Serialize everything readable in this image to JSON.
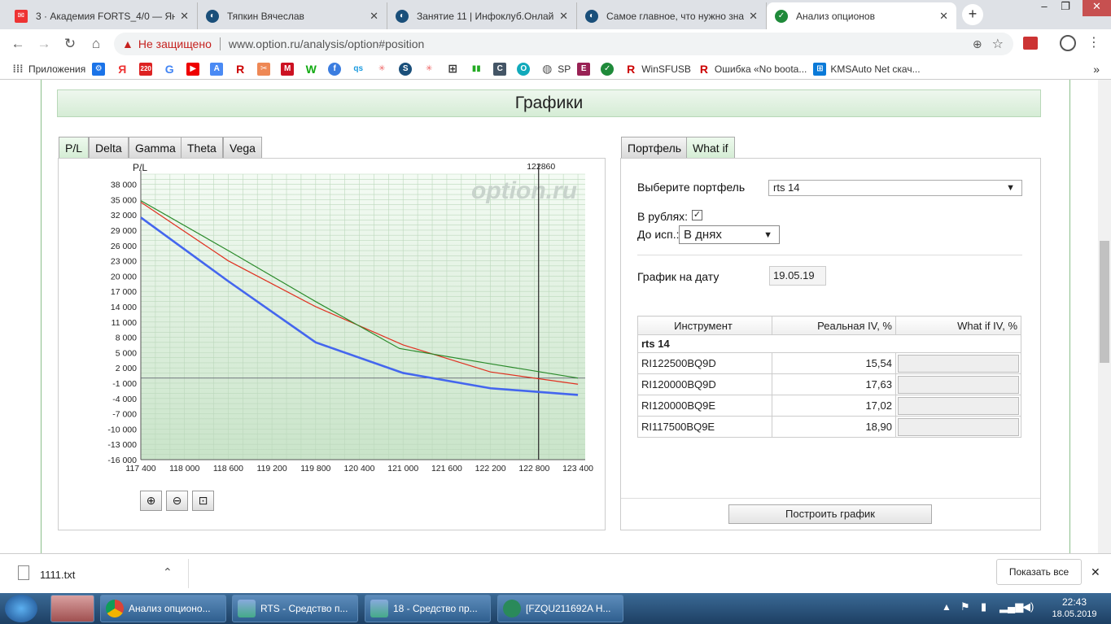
{
  "browser": {
    "tabs": [
      {
        "title": "3 · Академия FORTS_4/0 — Янд",
        "icon": "mail-icon"
      },
      {
        "title": "Тяпкин Вячеслав",
        "icon": "infoclub-icon"
      },
      {
        "title": "Занятие 11 | Инфоклуб.Онлайн",
        "icon": "infoclub-icon"
      },
      {
        "title": "Самое главное, что нужно зна",
        "icon": "infoclub-icon"
      },
      {
        "title": "Анализ опционов",
        "icon": "option-ru-icon",
        "active": true
      }
    ],
    "insecure_label": "Не защищено",
    "url": "www.option.ru/analysis/option#position",
    "bookmarks": [
      {
        "label": "Приложения"
      },
      {
        "label": ""
      },
      {
        "label": ""
      },
      {
        "label": ""
      },
      {
        "label": ""
      },
      {
        "label": ""
      },
      {
        "label": ""
      },
      {
        "label": ""
      },
      {
        "label": ""
      },
      {
        "label": ""
      },
      {
        "label": ""
      },
      {
        "label": ""
      },
      {
        "label": ""
      },
      {
        "label": ""
      },
      {
        "label": ""
      },
      {
        "label": ""
      },
      {
        "label": ""
      },
      {
        "label": ""
      },
      {
        "label": "SP"
      },
      {
        "label": ""
      },
      {
        "label": ""
      },
      {
        "label": "WinSFUSB"
      },
      {
        "label": "Ошибка «No boota..."
      },
      {
        "label": "KMSAuto Net скач..."
      }
    ]
  },
  "page": {
    "header": "Графики",
    "chart_tabs": [
      "P/L",
      "Delta",
      "Gamma",
      "Theta",
      "Vega"
    ],
    "right_tabs": [
      "Портфель",
      "What if"
    ],
    "form": {
      "portfolio_label": "Выберите портфель",
      "portfolio_value": "rts 14",
      "rub_label": "В рублях:",
      "expiry_label": "До исп.:",
      "expiry_value": "В днях",
      "date_label": "График на дату",
      "date_value": "19.05.19"
    },
    "iv_table": {
      "headers": [
        "Инструмент",
        "Реальная IV, %",
        "What if IV, %"
      ],
      "group": "rts 14",
      "rows": [
        {
          "instrument": "RI122500BQ9D",
          "iv": "15,54"
        },
        {
          "instrument": "RI120000BQ9D",
          "iv": "17,63"
        },
        {
          "instrument": "RI120000BQ9E",
          "iv": "17,02"
        },
        {
          "instrument": "RI117500BQ9E",
          "iv": "18,90"
        }
      ]
    },
    "build_button": "Построить график",
    "watermark": "option.ru"
  },
  "chart_data": {
    "type": "line",
    "ylabel": "P/L",
    "marker_label": "122860",
    "marker_x": 122860,
    "xlim": [
      117400,
      123500
    ],
    "ylim": [
      -16000,
      40000
    ],
    "x_ticks": [
      "117 400",
      "118 000",
      "118 600",
      "119 200",
      "119 800",
      "120 400",
      "121 000",
      "121 600",
      "122 200",
      "122 800",
      "123 400"
    ],
    "y_ticks": [
      "38 000",
      "35 000",
      "32 000",
      "29 000",
      "26 000",
      "23 000",
      "20 000",
      "17 000",
      "14 000",
      "11 000",
      "8 000",
      "5 000",
      "2 000",
      "-1 000",
      "-4 000",
      "-7 000",
      "-10 000",
      "-13 000",
      "-16 000"
    ],
    "series": [
      {
        "color": "#4466ee",
        "x": [
          117400,
          118600,
          119800,
          121000,
          122200,
          123400
        ],
        "y": [
          31500,
          19000,
          7000,
          1000,
          -2000,
          -3300
        ]
      },
      {
        "color": "#e03020",
        "x": [
          117400,
          118600,
          119800,
          121000,
          122200,
          123400
        ],
        "y": [
          34500,
          23000,
          14000,
          6500,
          1200,
          -1200
        ]
      },
      {
        "color": "#2a8a2a",
        "x": [
          117400,
          118600,
          119800,
          120950,
          122200,
          123400
        ],
        "y": [
          34800,
          25000,
          15000,
          5800,
          2800,
          0
        ]
      }
    ],
    "grid": true
  },
  "download": {
    "file": "1111.txt",
    "show_all": "Показать все"
  },
  "taskbar": {
    "items": [
      "Анализ опционо...",
      "RTS - Средство п...",
      "18 - Средство пр...",
      "[FZQU211692A Н..."
    ],
    "time": "22:43",
    "date": "18.05.2019"
  }
}
